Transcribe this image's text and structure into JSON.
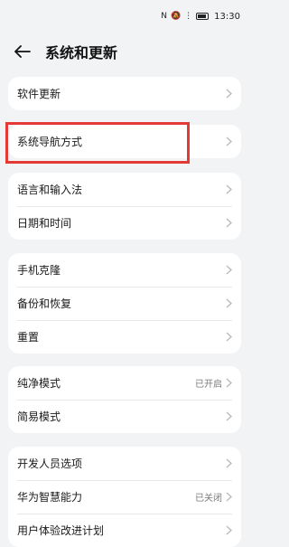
{
  "status_bar": {
    "time": "13:30",
    "battery_icon": "battery-icon"
  },
  "header": {
    "title": "系统和更新",
    "back_icon": "arrow-left-icon"
  },
  "groups": [
    {
      "items": [
        {
          "label": "软件更新"
        }
      ]
    },
    {
      "items": [
        {
          "label": "系统导航方式"
        }
      ]
    },
    {
      "items": [
        {
          "label": "语言和输入法"
        },
        {
          "label": "日期和时间"
        }
      ]
    },
    {
      "items": [
        {
          "label": "手机克隆"
        },
        {
          "label": "备份和恢复"
        },
        {
          "label": "重置"
        }
      ]
    },
    {
      "items": [
        {
          "label": "纯净模式",
          "status": "已开启"
        },
        {
          "label": "简易模式"
        }
      ]
    },
    {
      "items": [
        {
          "label": "开发人员选项"
        },
        {
          "label": "华为智慧能力",
          "status": "已关闭"
        },
        {
          "label": "用户体验改进计划"
        }
      ]
    }
  ],
  "annotation_color": "#e53935"
}
